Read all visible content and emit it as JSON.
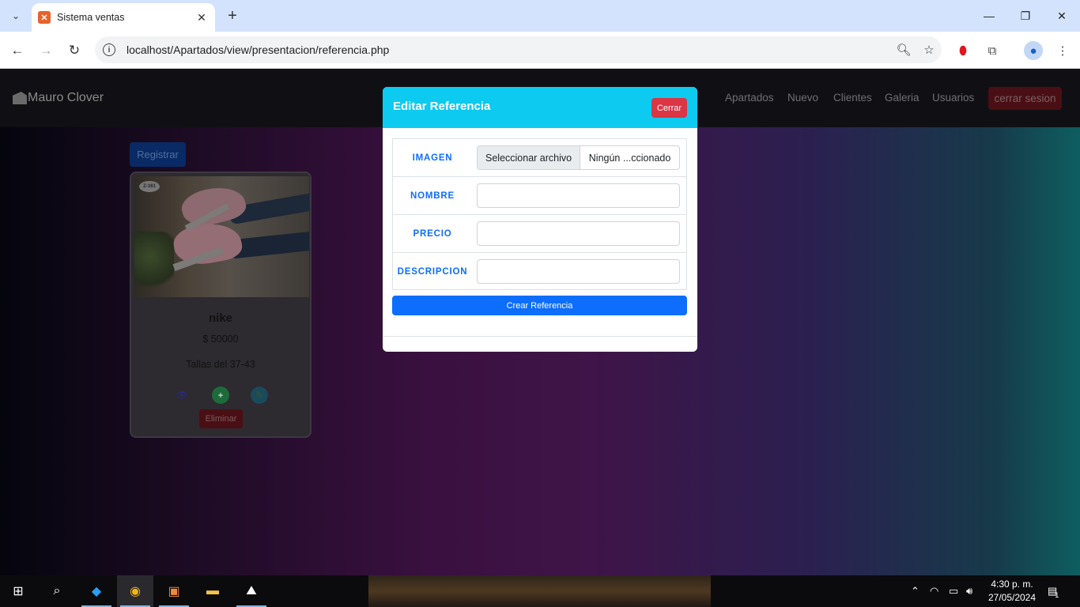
{
  "browser": {
    "tab_title": "Sistema ventas",
    "url": "localhost/Apartados/view/presentacion/referencia.php"
  },
  "navbar": {
    "brand": "Mauro Clover",
    "links": [
      "Apartados",
      "Nuevo",
      "Clientes",
      "Galeria",
      "Usuarios"
    ],
    "logout_label": "cerrar sesion"
  },
  "page": {
    "register_label": "Registrar"
  },
  "card": {
    "badge": "Z-161",
    "name": "nike",
    "price": "$ 50000",
    "description": "Tallas del 37-43",
    "delete_label": "Eliminar"
  },
  "modal": {
    "title": "Editar Referencia",
    "close_label": "Cerrar",
    "fields": {
      "imagen_label": "IMAGEN",
      "file_button": "Seleccionar archivo",
      "file_name": "Ningún ...ccionado",
      "nombre_label": "NOMBRE",
      "precio_label": "PRECIO",
      "descripcion_label": "DESCRIPCION"
    },
    "submit_label": "Crear Referencia"
  },
  "taskbar": {
    "time": "4:30 p. m.",
    "date": "27/05/2024",
    "notifications": "1"
  },
  "colors": {
    "modal_header": "#0dcaf0",
    "primary": "#0d6efd",
    "danger": "#dc3545"
  }
}
